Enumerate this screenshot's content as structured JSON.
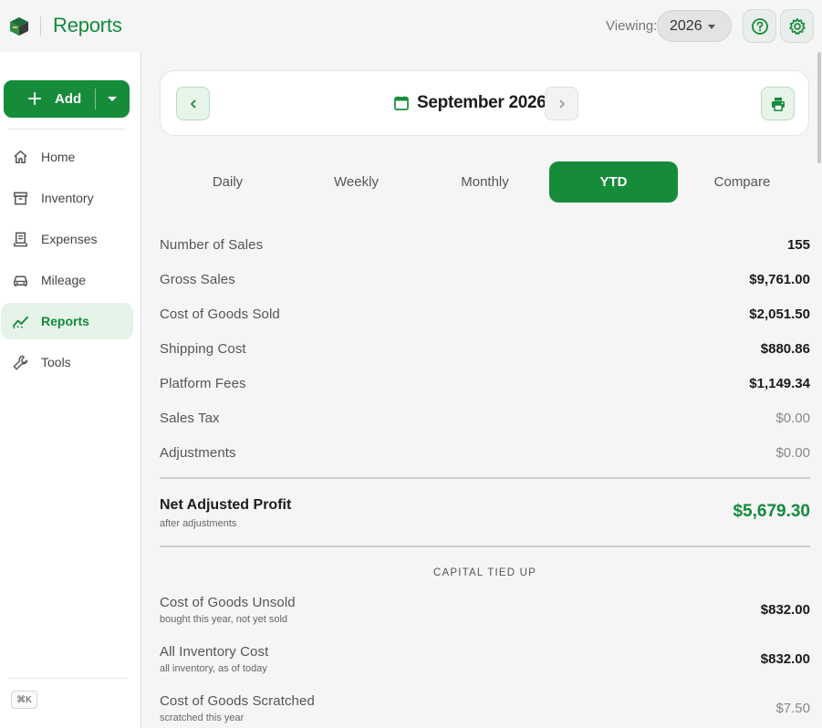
{
  "header": {
    "title": "Reports",
    "viewing_label": "Viewing:",
    "year": "2026"
  },
  "colors": {
    "brand": "#168c3b",
    "brand_text": "#138a3c",
    "active_bg": "#e6f3e8"
  },
  "icons": [
    "logo-icon",
    "help-icon",
    "settings-icon",
    "plus-icon",
    "home-icon",
    "inventory-icon",
    "expenses-icon",
    "mileage-icon",
    "reports-icon",
    "tools-icon",
    "calendar-icon",
    "chevron-left-icon",
    "chevron-right-icon",
    "print-icon"
  ],
  "sidebar": {
    "add_label": "Add",
    "items": [
      {
        "label": "Home"
      },
      {
        "label": "Inventory"
      },
      {
        "label": "Expenses"
      },
      {
        "label": "Mileage"
      },
      {
        "label": "Reports"
      },
      {
        "label": "Tools"
      }
    ],
    "shortcut": "⌘K"
  },
  "report": {
    "period_title": "September 2026",
    "tabs": [
      {
        "label": "Daily"
      },
      {
        "label": "Weekly"
      },
      {
        "label": "Monthly"
      },
      {
        "label": "YTD"
      },
      {
        "label": "Compare"
      }
    ],
    "rows": [
      {
        "label": "Number of Sales",
        "value": "155"
      },
      {
        "label": "Gross Sales",
        "value": "$9,761.00"
      },
      {
        "label": "Cost of Goods Sold",
        "value": "$2,051.50"
      },
      {
        "label": "Shipping Cost",
        "value": "$880.86"
      },
      {
        "label": "Platform Fees",
        "value": "$1,149.34"
      },
      {
        "label": "Sales Tax",
        "value": "$0.00"
      },
      {
        "label": "Adjustments",
        "value": "$0.00"
      }
    ],
    "net": {
      "label": "Net Adjusted Profit",
      "sub": "after adjustments",
      "value": "$5,679.30"
    },
    "capital": {
      "title": "CAPITAL TIED UP",
      "rows": [
        {
          "label": "Cost of Goods Unsold",
          "sub": "bought this year, not yet sold",
          "value": "$832.00"
        },
        {
          "label": "All Inventory Cost",
          "sub": "all inventory, as of today",
          "value": "$832.00"
        },
        {
          "label": "Cost of Goods Scratched",
          "sub": "scratched this year",
          "value": "$7.50"
        }
      ]
    }
  }
}
